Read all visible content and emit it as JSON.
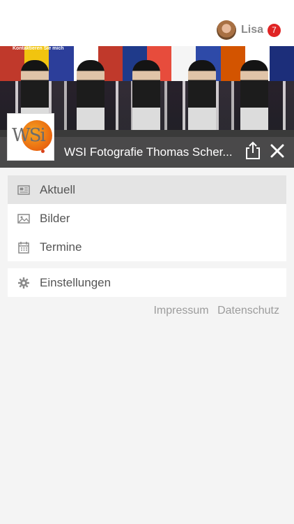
{
  "header": {
    "username": "Lisa",
    "notification_count": "7"
  },
  "banner": {
    "contact_text": "Kontaktieren Sie mich",
    "site_title": "WSI Fotografie Thomas Scher..."
  },
  "logo": {
    "text": "WSi"
  },
  "menu": {
    "main_items": [
      {
        "label": "Aktuell",
        "icon": "newspaper-icon",
        "active": true
      },
      {
        "label": "Bilder",
        "icon": "image-icon",
        "active": false
      },
      {
        "label": "Termine",
        "icon": "calendar-icon",
        "active": false
      }
    ],
    "settings_label": "Einstellungen"
  },
  "footer": {
    "impressum": "Impressum",
    "datenschutz": "Datenschutz"
  },
  "colors": {
    "badge": "#e02424",
    "title_bar": "#4b4b4b",
    "active_item": "#e4e4e4",
    "text": "#555555"
  }
}
